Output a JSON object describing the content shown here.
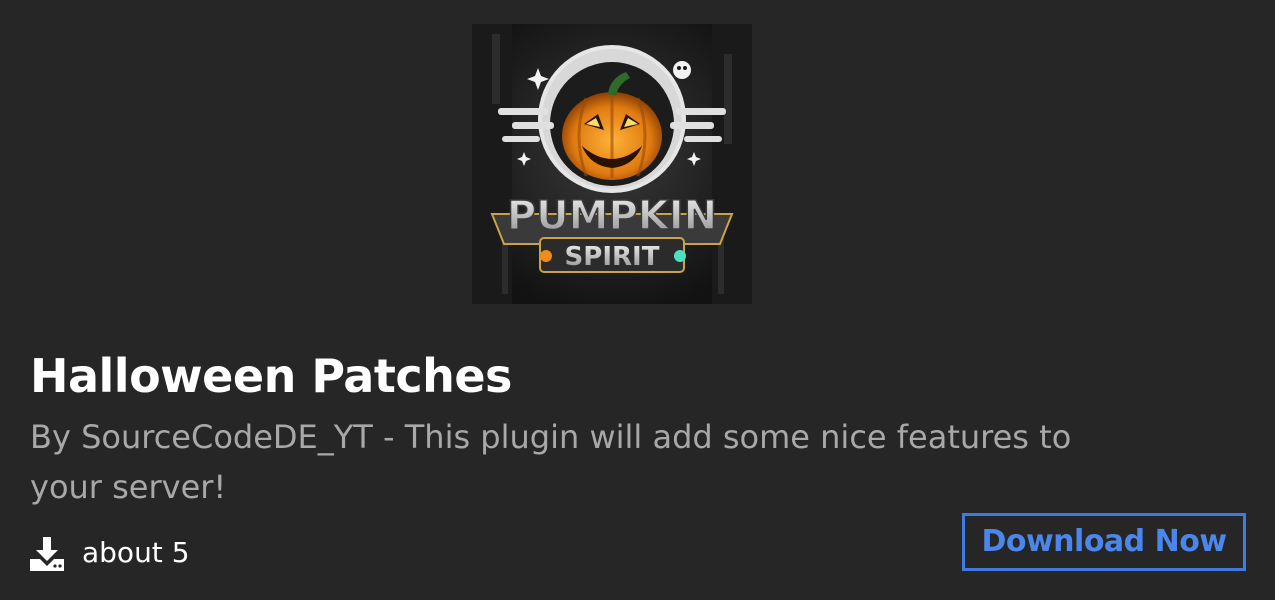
{
  "plugin": {
    "title": "Halloween Patches",
    "description": "By SourceCodeDE_YT - This plugin will add some nice features to your server!",
    "downloads": "about 5",
    "download_button_label": "Download Now",
    "thumbnail": {
      "logo_line1": "PUMPKIN",
      "logo_line2": "SPIRIT"
    }
  },
  "icons": {
    "downloads": "download-icon"
  },
  "colors": {
    "background": "#262626",
    "title": "#ffffff",
    "description": "#a8a8a8",
    "accent": "#4b86ec",
    "pumpkin": "#f28a1c"
  }
}
